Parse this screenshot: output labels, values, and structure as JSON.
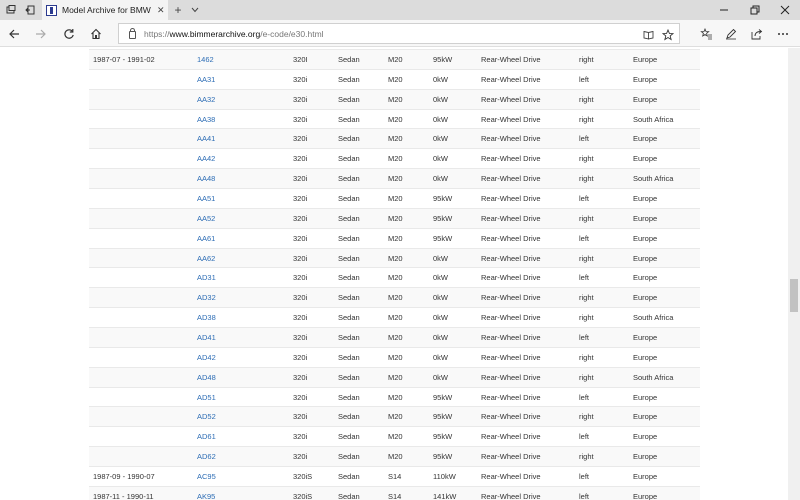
{
  "browser": {
    "tab_title": "Model Archive for BMW",
    "url_prefix": "https://",
    "url_host": "www.bimmerarchive.org",
    "url_path": "/e-code/e30.html"
  },
  "table": {
    "rows": [
      {
        "date": "1987-07 - 1991-02",
        "code": "1462",
        "model": "320I",
        "body": "Sedan",
        "engine": "M20",
        "power": "95kW",
        "drive": "Rear-Wheel Drive",
        "steering": "right",
        "market": "Europe"
      },
      {
        "date": "",
        "code": "AA31",
        "model": "320i",
        "body": "Sedan",
        "engine": "M20",
        "power": "0kW",
        "drive": "Rear-Wheel Drive",
        "steering": "left",
        "market": "Europe"
      },
      {
        "date": "",
        "code": "AA32",
        "model": "320i",
        "body": "Sedan",
        "engine": "M20",
        "power": "0kW",
        "drive": "Rear-Wheel Drive",
        "steering": "right",
        "market": "Europe"
      },
      {
        "date": "",
        "code": "AA38",
        "model": "320i",
        "body": "Sedan",
        "engine": "M20",
        "power": "0kW",
        "drive": "Rear-Wheel Drive",
        "steering": "right",
        "market": "South Africa"
      },
      {
        "date": "",
        "code": "AA41",
        "model": "320i",
        "body": "Sedan",
        "engine": "M20",
        "power": "0kW",
        "drive": "Rear-Wheel Drive",
        "steering": "left",
        "market": "Europe"
      },
      {
        "date": "",
        "code": "AA42",
        "model": "320i",
        "body": "Sedan",
        "engine": "M20",
        "power": "0kW",
        "drive": "Rear-Wheel Drive",
        "steering": "right",
        "market": "Europe"
      },
      {
        "date": "",
        "code": "AA48",
        "model": "320i",
        "body": "Sedan",
        "engine": "M20",
        "power": "0kW",
        "drive": "Rear-Wheel Drive",
        "steering": "right",
        "market": "South Africa"
      },
      {
        "date": "",
        "code": "AA51",
        "model": "320i",
        "body": "Sedan",
        "engine": "M20",
        "power": "95kW",
        "drive": "Rear-Wheel Drive",
        "steering": "left",
        "market": "Europe"
      },
      {
        "date": "",
        "code": "AA52",
        "model": "320i",
        "body": "Sedan",
        "engine": "M20",
        "power": "95kW",
        "drive": "Rear-Wheel Drive",
        "steering": "right",
        "market": "Europe"
      },
      {
        "date": "",
        "code": "AA61",
        "model": "320i",
        "body": "Sedan",
        "engine": "M20",
        "power": "95kW",
        "drive": "Rear-Wheel Drive",
        "steering": "left",
        "market": "Europe"
      },
      {
        "date": "",
        "code": "AA62",
        "model": "320i",
        "body": "Sedan",
        "engine": "M20",
        "power": "0kW",
        "drive": "Rear-Wheel Drive",
        "steering": "right",
        "market": "Europe"
      },
      {
        "date": "",
        "code": "AD31",
        "model": "320i",
        "body": "Sedan",
        "engine": "M20",
        "power": "0kW",
        "drive": "Rear-Wheel Drive",
        "steering": "left",
        "market": "Europe"
      },
      {
        "date": "",
        "code": "AD32",
        "model": "320i",
        "body": "Sedan",
        "engine": "M20",
        "power": "0kW",
        "drive": "Rear-Wheel Drive",
        "steering": "right",
        "market": "Europe"
      },
      {
        "date": "",
        "code": "AD38",
        "model": "320i",
        "body": "Sedan",
        "engine": "M20",
        "power": "0kW",
        "drive": "Rear-Wheel Drive",
        "steering": "right",
        "market": "South Africa"
      },
      {
        "date": "",
        "code": "AD41",
        "model": "320i",
        "body": "Sedan",
        "engine": "M20",
        "power": "0kW",
        "drive": "Rear-Wheel Drive",
        "steering": "left",
        "market": "Europe"
      },
      {
        "date": "",
        "code": "AD42",
        "model": "320i",
        "body": "Sedan",
        "engine": "M20",
        "power": "0kW",
        "drive": "Rear-Wheel Drive",
        "steering": "right",
        "market": "Europe"
      },
      {
        "date": "",
        "code": "AD48",
        "model": "320i",
        "body": "Sedan",
        "engine": "M20",
        "power": "0kW",
        "drive": "Rear-Wheel Drive",
        "steering": "right",
        "market": "South Africa"
      },
      {
        "date": "",
        "code": "AD51",
        "model": "320i",
        "body": "Sedan",
        "engine": "M20",
        "power": "95kW",
        "drive": "Rear-Wheel Drive",
        "steering": "left",
        "market": "Europe"
      },
      {
        "date": "",
        "code": "AD52",
        "model": "320i",
        "body": "Sedan",
        "engine": "M20",
        "power": "95kW",
        "drive": "Rear-Wheel Drive",
        "steering": "right",
        "market": "Europe"
      },
      {
        "date": "",
        "code": "AD61",
        "model": "320i",
        "body": "Sedan",
        "engine": "M20",
        "power": "95kW",
        "drive": "Rear-Wheel Drive",
        "steering": "left",
        "market": "Europe"
      },
      {
        "date": "",
        "code": "AD62",
        "model": "320i",
        "body": "Sedan",
        "engine": "M20",
        "power": "95kW",
        "drive": "Rear-Wheel Drive",
        "steering": "right",
        "market": "Europe"
      },
      {
        "date": "1987-09 - 1990-07",
        "code": "AC95",
        "model": "320iS",
        "body": "Sedan",
        "engine": "S14",
        "power": "110kW",
        "drive": "Rear-Wheel Drive",
        "steering": "left",
        "market": "Europe"
      },
      {
        "date": "1987-11 - 1990-11",
        "code": "AK95",
        "model": "320iS",
        "body": "Sedan",
        "engine": "S14",
        "power": "141kW",
        "drive": "Rear-Wheel Drive",
        "steering": "left",
        "market": "Europe"
      }
    ]
  },
  "icons": {
    "tab_actions": "tab-actions-icon",
    "set_aside": "tabs-aside-icon",
    "back": "arrow-left-icon",
    "forward": "arrow-right-icon",
    "refresh": "refresh-icon",
    "home": "home-icon",
    "reading_view": "book-icon",
    "favorite": "star-icon",
    "favorites_hub": "favorites-icon",
    "notes": "pen-icon",
    "share": "share-icon",
    "more": "ellipsis-icon"
  },
  "colors": {
    "link": "#2d6db5",
    "row_alt": "#f9f9f9"
  }
}
